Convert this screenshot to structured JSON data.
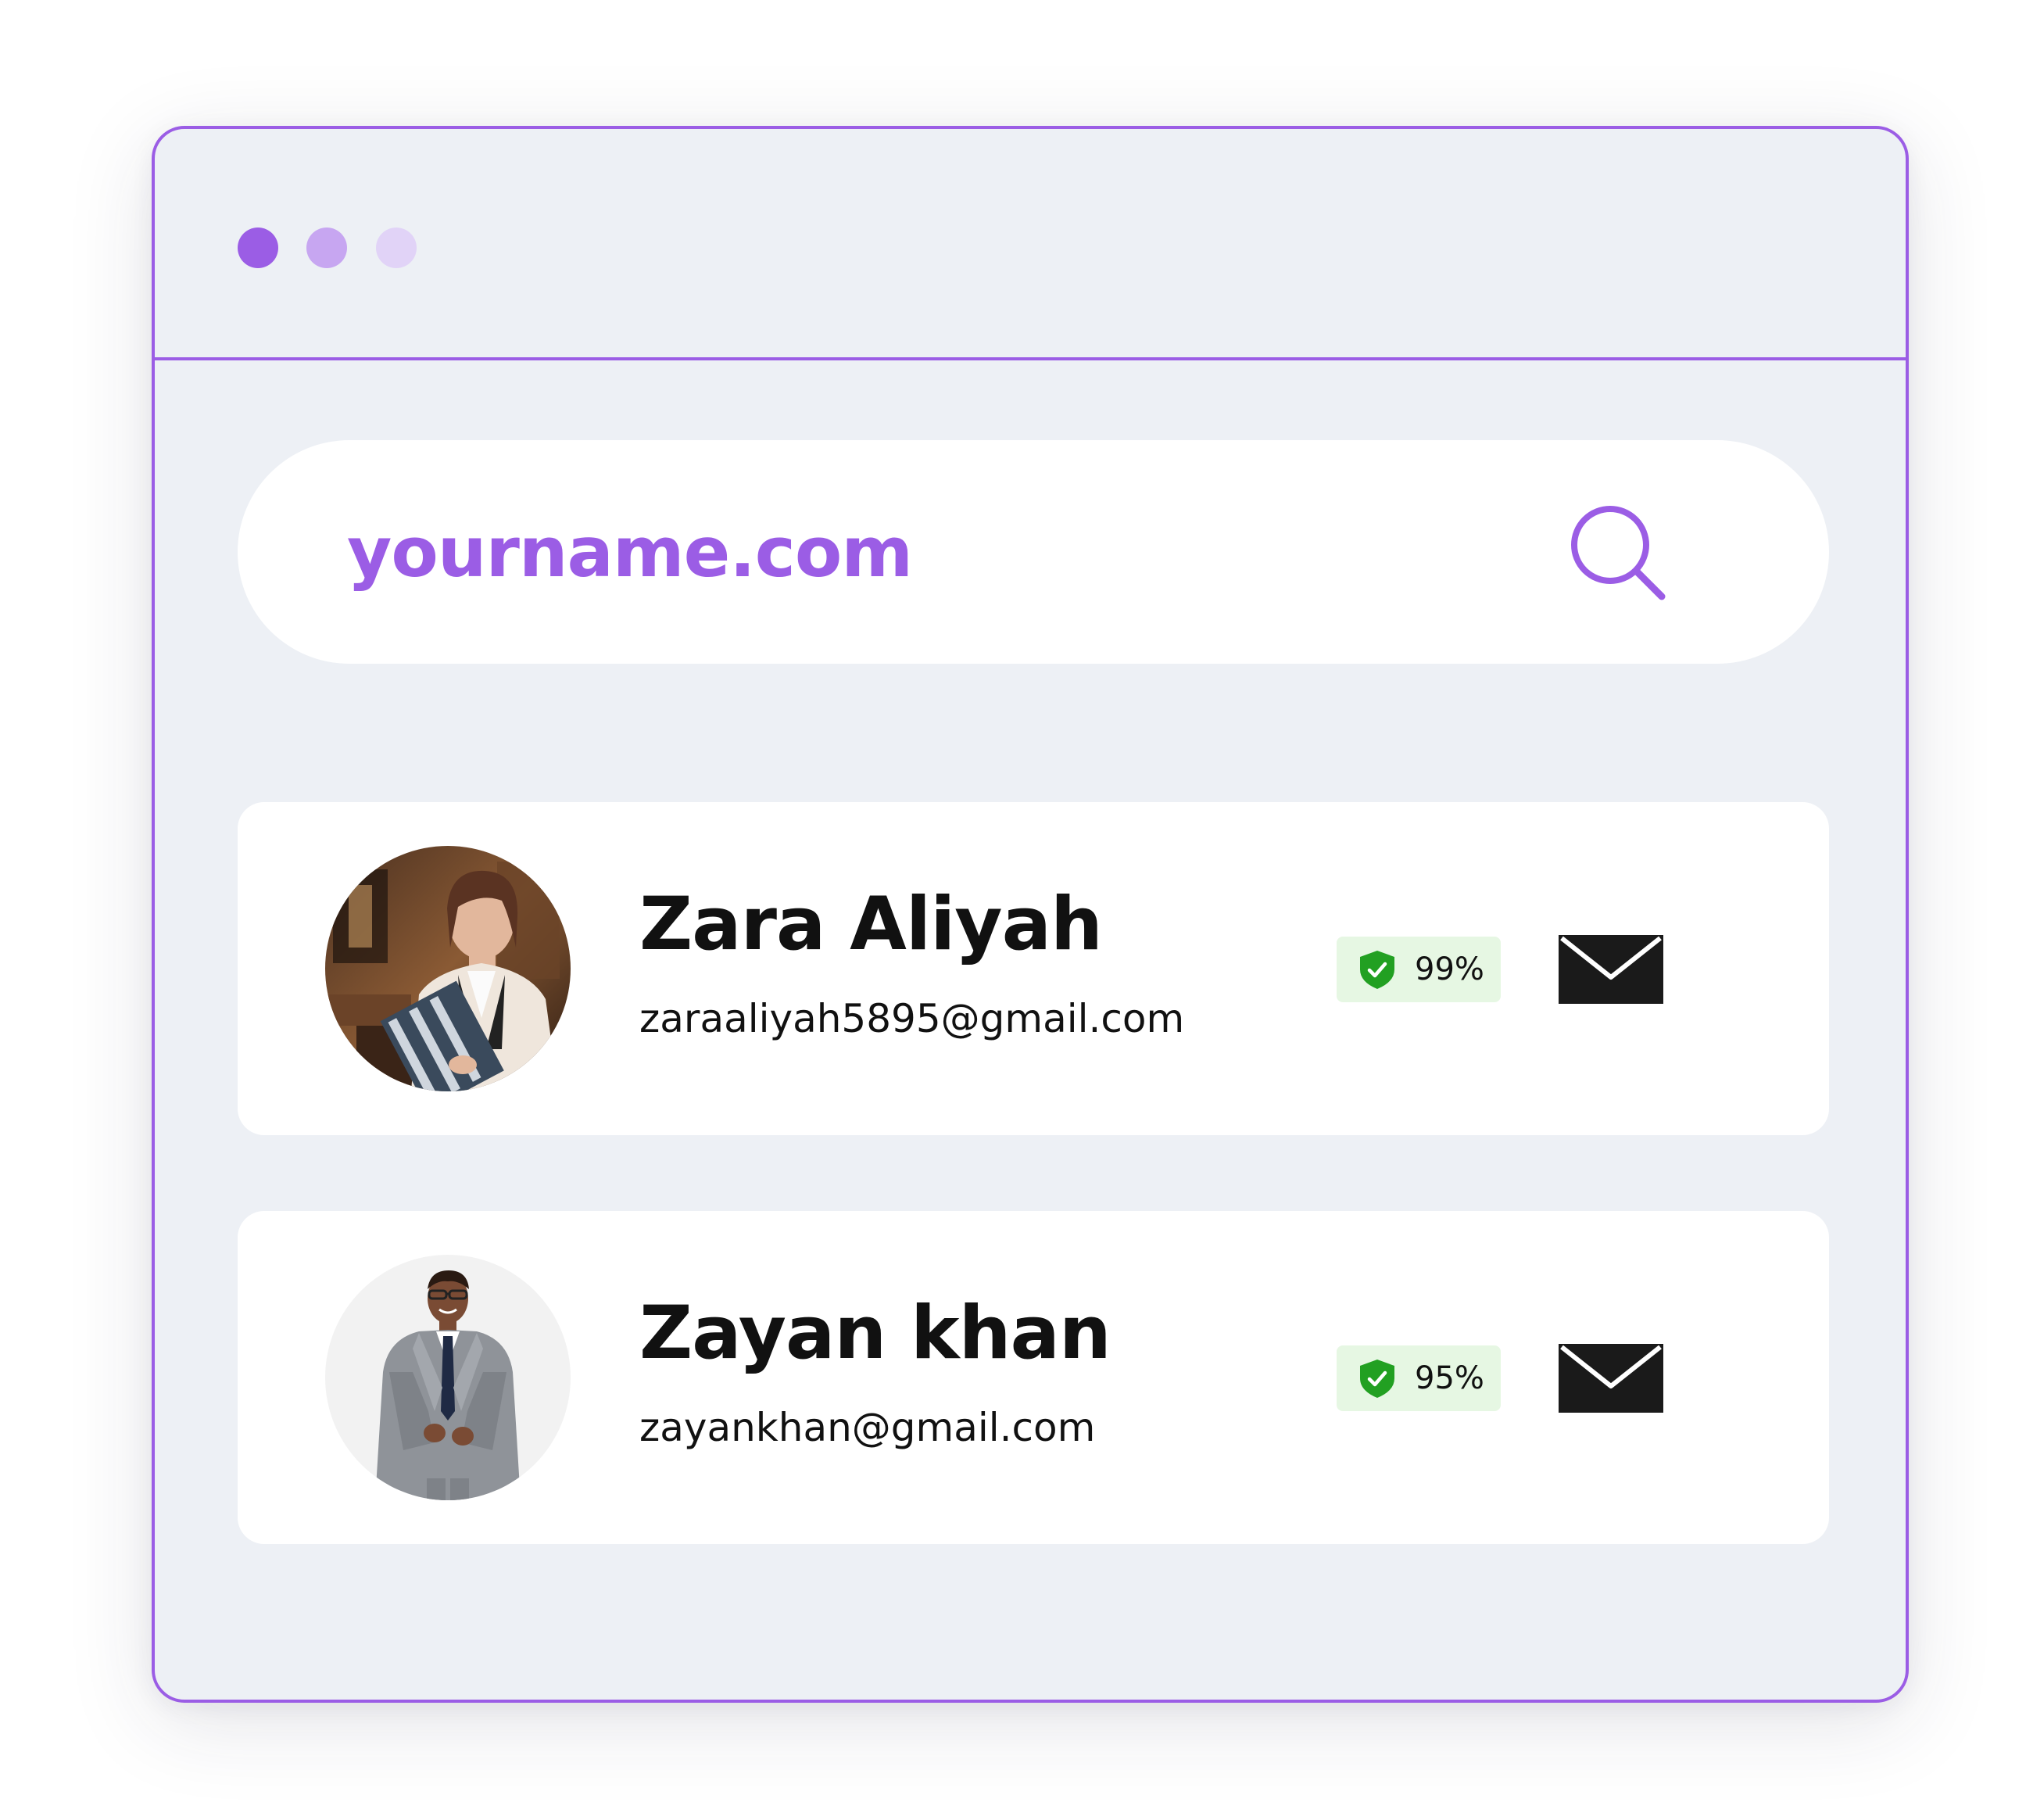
{
  "window": {
    "dots": [
      "close",
      "minimize",
      "maximize"
    ]
  },
  "search": {
    "value": "yourname.com",
    "icon": "search-icon"
  },
  "results": [
    {
      "name": "Zara Aliyah",
      "email": "zaraaliyah5895@gmail.com",
      "score": "99%",
      "avatar": "woman-with-binders-photo",
      "badge_icon": "shield-check-icon",
      "action_icon": "mail-icon"
    },
    {
      "name": "Zayan khan",
      "email": "zayankhan@gmail.com",
      "score": "95%",
      "avatar": "man-in-grey-suit-photo",
      "badge_icon": "shield-check-icon",
      "action_icon": "mail-icon"
    }
  ],
  "colors": {
    "accent": "#9b5de5",
    "window_bg": "#edf0f5",
    "badge_bg": "#e6f7e3",
    "badge_icon": "#22a022",
    "text": "#111111"
  }
}
